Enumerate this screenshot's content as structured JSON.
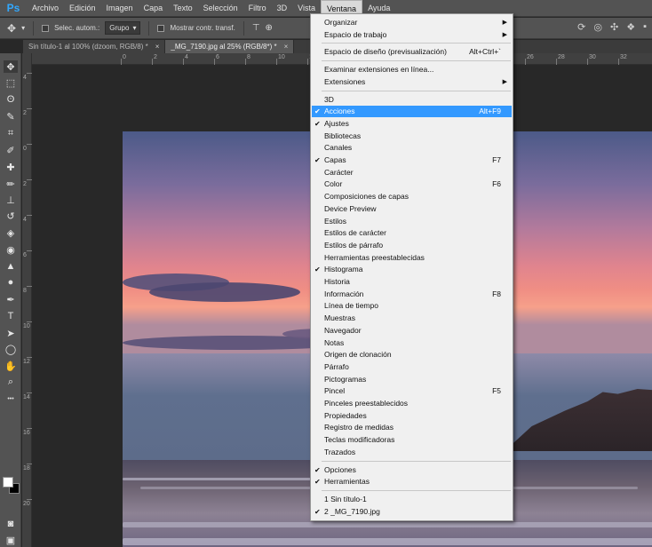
{
  "menubar": {
    "logo": "Ps",
    "items": [
      "Archivo",
      "Edición",
      "Imagen",
      "Capa",
      "Texto",
      "Selección",
      "Filtro",
      "3D",
      "Vista",
      "Ventana",
      "Ayuda"
    ],
    "active": "Ventana"
  },
  "options_bar": {
    "auto_select_label": "Selec. autom.:",
    "group_select_value": "Grupo",
    "show_transform_label": "Mostrar contr. transf."
  },
  "tabs": [
    {
      "label": "Sin título-1 al 100% (dzoom, RGB/8) *",
      "active": false
    },
    {
      "label": "_MG_7190.jpg al 25% (RGB/8*) *",
      "active": true
    }
  ],
  "ruler": {
    "top_numbers": [
      "0",
      "2",
      "4",
      "6",
      "8",
      "10",
      "12",
      "14",
      "16",
      "18",
      "20",
      "22",
      "24",
      "26",
      "28",
      "30",
      "32",
      "34",
      "36"
    ],
    "left_numbers": [
      "4",
      "2",
      "0",
      "2",
      "4",
      "6",
      "8",
      "10",
      "12",
      "14",
      "16",
      "18",
      "20"
    ]
  },
  "window_menu": {
    "sections": [
      [
        {
          "label": "Organizar",
          "submenu": true
        },
        {
          "label": "Espacio de trabajo",
          "submenu": true
        }
      ],
      [
        {
          "label": "Espacio de diseño (previsualización)",
          "shortcut": "Alt+Ctrl+`"
        }
      ],
      [
        {
          "label": "Examinar extensiones en línea..."
        },
        {
          "label": "Extensiones",
          "submenu": true
        }
      ],
      [
        {
          "label": "3D"
        },
        {
          "label": "Acciones",
          "checked": true,
          "shortcut": "Alt+F9",
          "highlighted": true
        },
        {
          "label": "Ajustes",
          "checked": true
        },
        {
          "label": "Bibliotecas"
        },
        {
          "label": "Canales"
        },
        {
          "label": "Capas",
          "checked": true,
          "shortcut": "F7"
        },
        {
          "label": "Carácter"
        },
        {
          "label": "Color",
          "shortcut": "F6"
        },
        {
          "label": "Composiciones de capas"
        },
        {
          "label": "Device Preview"
        },
        {
          "label": "Estilos"
        },
        {
          "label": "Estilos de carácter"
        },
        {
          "label": "Estilos de párrafo"
        },
        {
          "label": "Herramientas preestablecidas"
        },
        {
          "label": "Histograma",
          "checked": true
        },
        {
          "label": "Historia"
        },
        {
          "label": "Información",
          "shortcut": "F8"
        },
        {
          "label": "Línea de tiempo"
        },
        {
          "label": "Muestras"
        },
        {
          "label": "Navegador"
        },
        {
          "label": "Notas"
        },
        {
          "label": "Origen de clonación"
        },
        {
          "label": "Párrafo"
        },
        {
          "label": "Pictogramas"
        },
        {
          "label": "Pincel",
          "shortcut": "F5"
        },
        {
          "label": "Pinceles preestablecidos"
        },
        {
          "label": "Propiedades"
        },
        {
          "label": "Registro de medidas"
        },
        {
          "label": "Teclas modificadoras"
        },
        {
          "label": "Trazados"
        }
      ],
      [
        {
          "label": "Opciones",
          "checked": true
        },
        {
          "label": "Herramientas",
          "checked": true
        }
      ],
      [
        {
          "label": "1 Sin título-1"
        },
        {
          "label": "2 _MG_7190.jpg",
          "checked": true
        }
      ]
    ]
  },
  "tools": [
    {
      "name": "move-tool",
      "glyph": "✥"
    },
    {
      "name": "marquee-tool",
      "glyph": "⬚"
    },
    {
      "name": "lasso-tool",
      "glyph": "ʘ"
    },
    {
      "name": "quick-selection-tool",
      "glyph": "✎"
    },
    {
      "name": "crop-tool",
      "glyph": "⌗"
    },
    {
      "name": "eyedropper-tool",
      "glyph": "✐"
    },
    {
      "name": "healing-brush-tool",
      "glyph": "✚"
    },
    {
      "name": "brush-tool",
      "glyph": "✏"
    },
    {
      "name": "clone-stamp-tool",
      "glyph": "⊥"
    },
    {
      "name": "history-brush-tool",
      "glyph": "↺"
    },
    {
      "name": "eraser-tool",
      "glyph": "◈"
    },
    {
      "name": "paint-bucket-tool",
      "glyph": "◉"
    },
    {
      "name": "blur-tool",
      "glyph": "▲"
    },
    {
      "name": "dodge-tool",
      "glyph": "●"
    },
    {
      "name": "pen-tool",
      "glyph": "✒"
    },
    {
      "name": "type-tool",
      "glyph": "T"
    },
    {
      "name": "path-selection-tool",
      "glyph": "➤"
    },
    {
      "name": "shape-tool",
      "glyph": "◯"
    },
    {
      "name": "hand-tool",
      "glyph": "✋"
    },
    {
      "name": "zoom-tool",
      "glyph": "⌕"
    },
    {
      "name": "more-tools",
      "glyph": "•••"
    }
  ],
  "colors": {
    "foreground": "#ffffff",
    "background": "#000000",
    "highlight": "#3399ff"
  }
}
